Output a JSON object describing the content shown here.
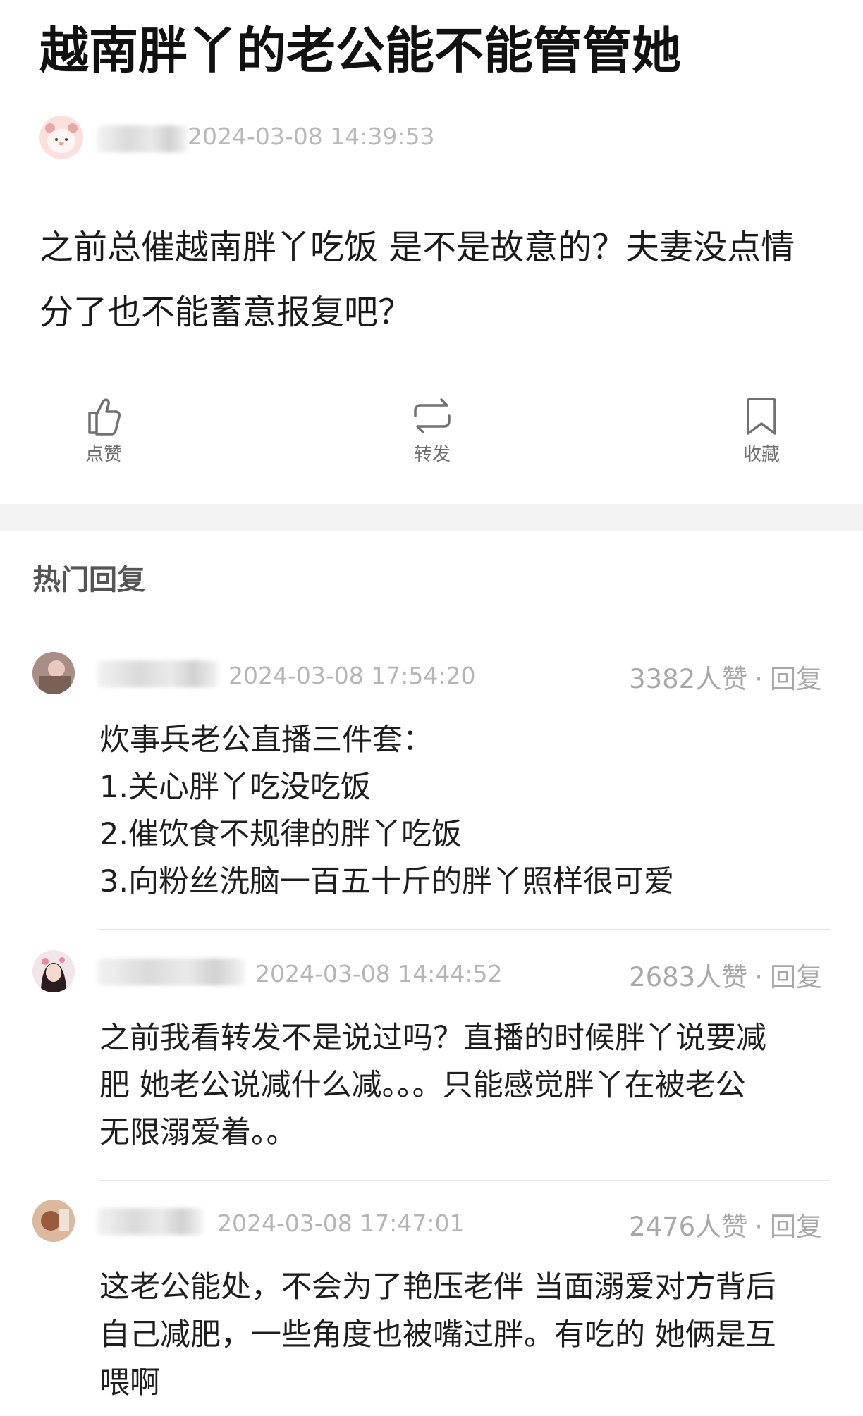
{
  "post": {
    "title": "越南胖丫的老公能不能管管她",
    "author": {
      "time": "2024-03-08 14:39:53"
    },
    "body": "之前总催越南胖丫吃饭 是不是故意的？夫妻没点情分了也不能蓄意报复吧？"
  },
  "actions": [
    {
      "label": "点赞",
      "icon": "thumbs-up-icon"
    },
    {
      "label": "转发",
      "icon": "repost-icon"
    },
    {
      "label": "收藏",
      "icon": "bookmark-icon"
    }
  ],
  "section": {
    "title": "热门回复"
  },
  "comments": [
    {
      "time": "2024-03-08 17:54:20",
      "likes": "3382人赞",
      "reply_label": "回复",
      "lines": [
        "炊事兵老公直播三件套：",
        "1.关心胖丫吃没吃饭",
        "2.催饮食不规律的胖丫吃饭",
        "3.向粉丝洗脑一百五十斤的胖丫照样很可爱"
      ]
    },
    {
      "time": "2024-03-08 14:44:52",
      "likes": "2683人赞",
      "reply_label": "回复",
      "lines": [
        "之前我看转发不是说过吗？直播的时候胖丫说要减",
        "肥 她老公说减什么减。。。只能感觉胖丫在被老公",
        "无限溺爱着。。"
      ]
    },
    {
      "time": "2024-03-08 17:47:01",
      "likes": "2476人赞",
      "reply_label": "回复",
      "lines": [
        "这老公能处，不会为了艳压老伴 当面溺爱对方背后",
        "自己减肥，一些角度也被嘴过胖。有吃的 她俩是互",
        "喂啊"
      ]
    }
  ],
  "colors": {
    "meta": "#a8a8a8",
    "band": "#f3f3f3",
    "text": "#1a1a1a"
  }
}
